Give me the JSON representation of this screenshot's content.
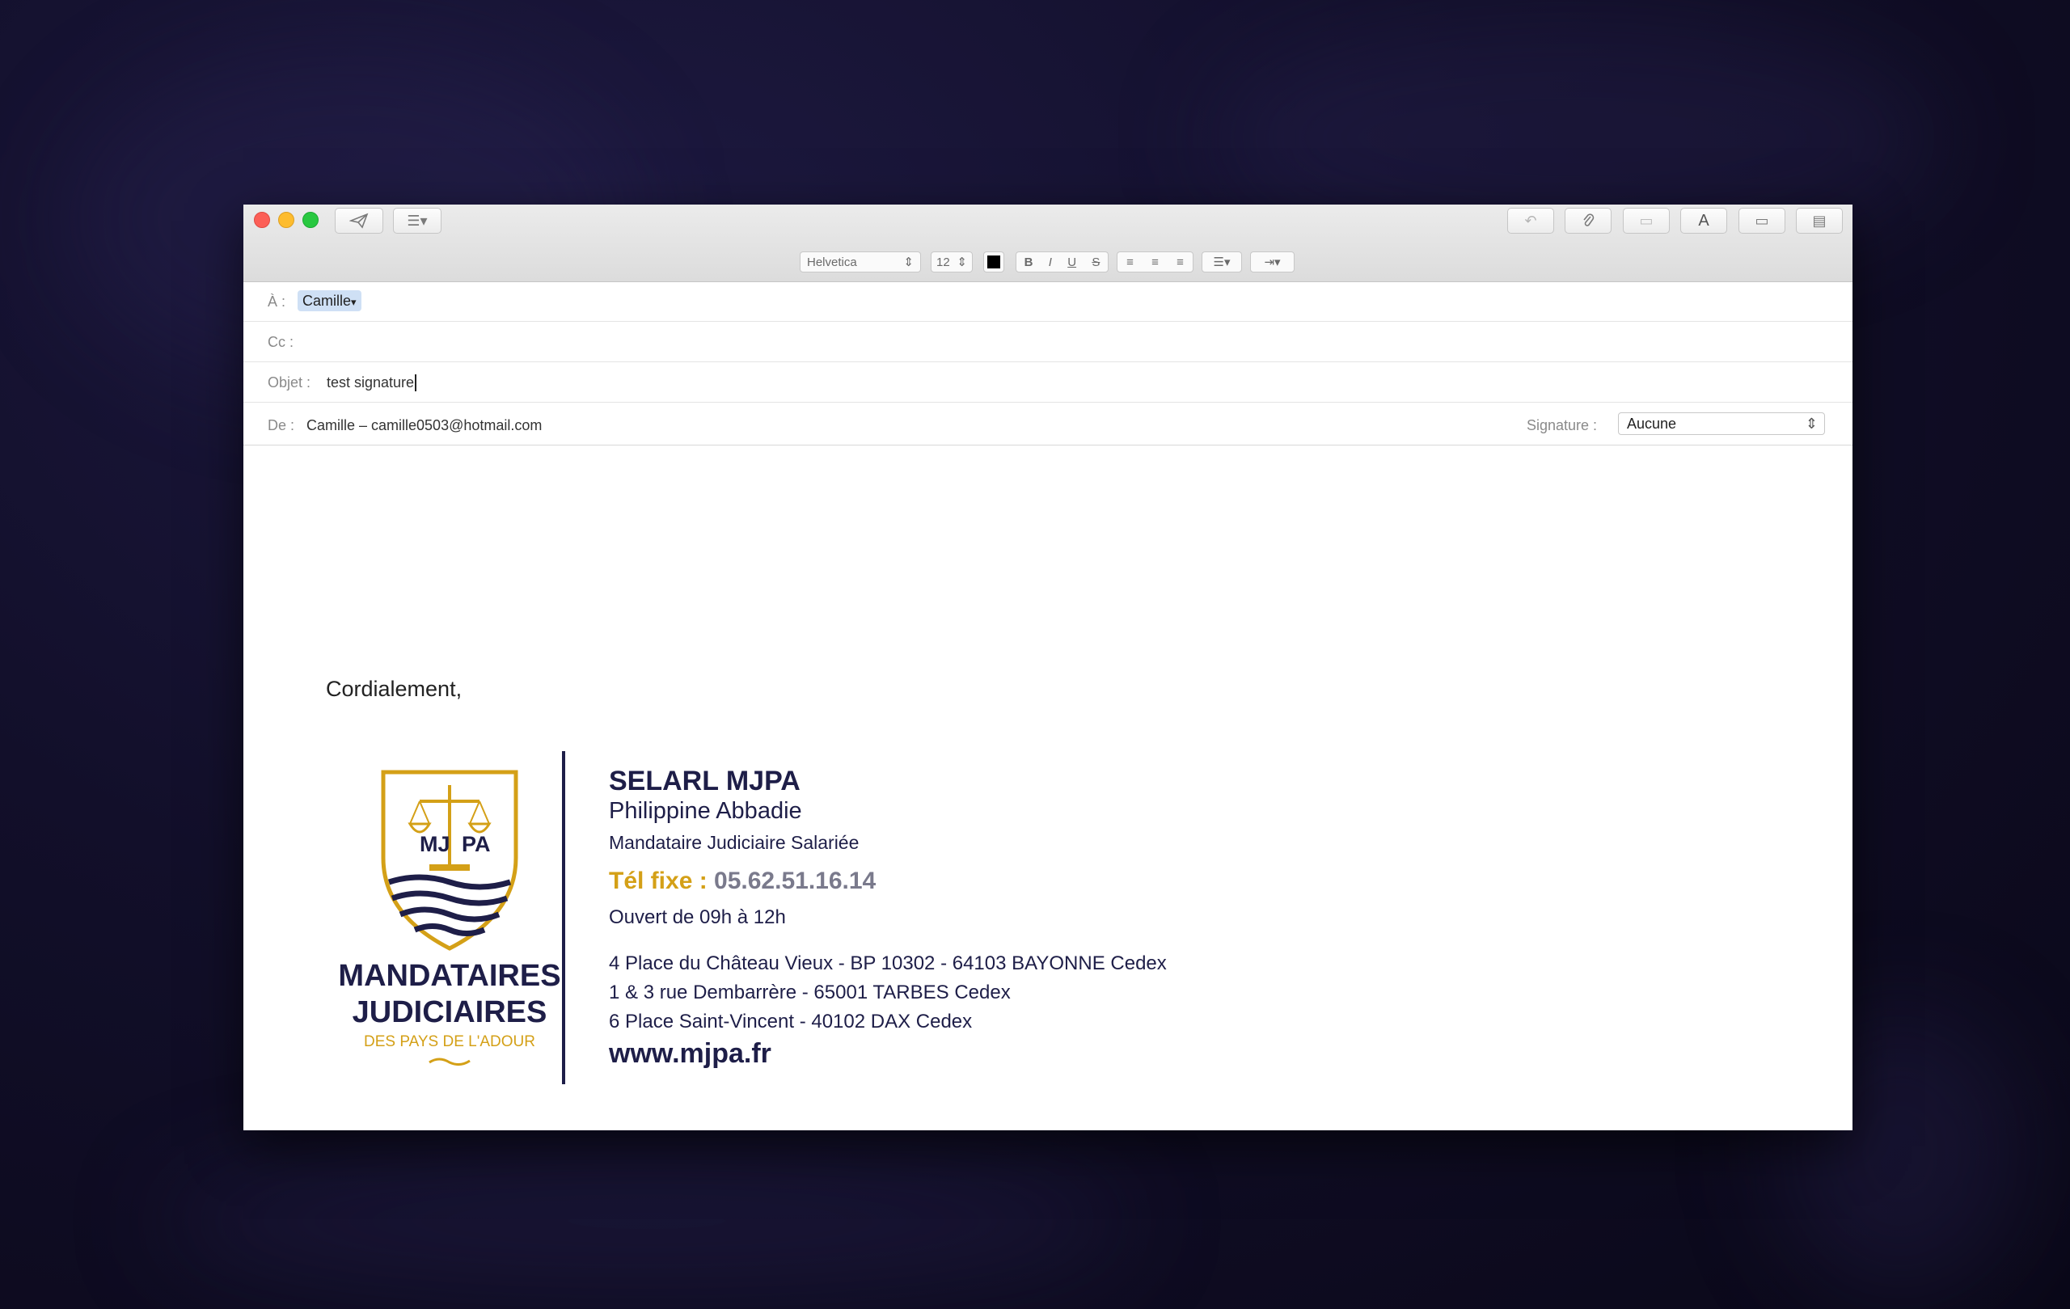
{
  "window": {
    "toolbar": {
      "font_name": "Helvetica",
      "font_size": "12",
      "bold": "B",
      "italic": "I",
      "underline": "U",
      "strike": "S",
      "font_button": "A"
    }
  },
  "header": {
    "to_label": "À :",
    "to_value": "Camille",
    "cc_label": "Cc :",
    "subject_label": "Objet :",
    "subject_value": "test signature",
    "from_label": "De :",
    "from_value": "Camille – camille0503@hotmail.com",
    "signature_label": "Signature :",
    "signature_value": "Aucune"
  },
  "body": {
    "greeting": "Cordialement,",
    "logo": {
      "left_letters": "MJ",
      "right_letters": "PA",
      "line1": "MANDATAIRES",
      "line2": "JUDICIAIRES",
      "line3": "DES PAYS DE L'ADOUR"
    },
    "company": "SELARL MJPA",
    "person": "Philippine Abbadie",
    "role": "Mandataire Judiciaire Salariée",
    "phone_label": "Tél fixe :",
    "phone_value": "05.62.51.16.14",
    "hours": "Ouvert de 09h à 12h",
    "addresses": [
      "4 Place du Château Vieux - BP 10302 - 64103 BAYONNE Cedex",
      "1 & 3 rue Dembarrère - 65001 TARBES Cedex",
      "6 Place Saint-Vincent - 40102 DAX Cedex"
    ],
    "website": "www.mjpa.fr"
  },
  "colors": {
    "navy": "#1e1e48",
    "gold": "#d4a017",
    "red": "#fc5f57",
    "yellow": "#fdbc2e",
    "green": "#28c840"
  }
}
